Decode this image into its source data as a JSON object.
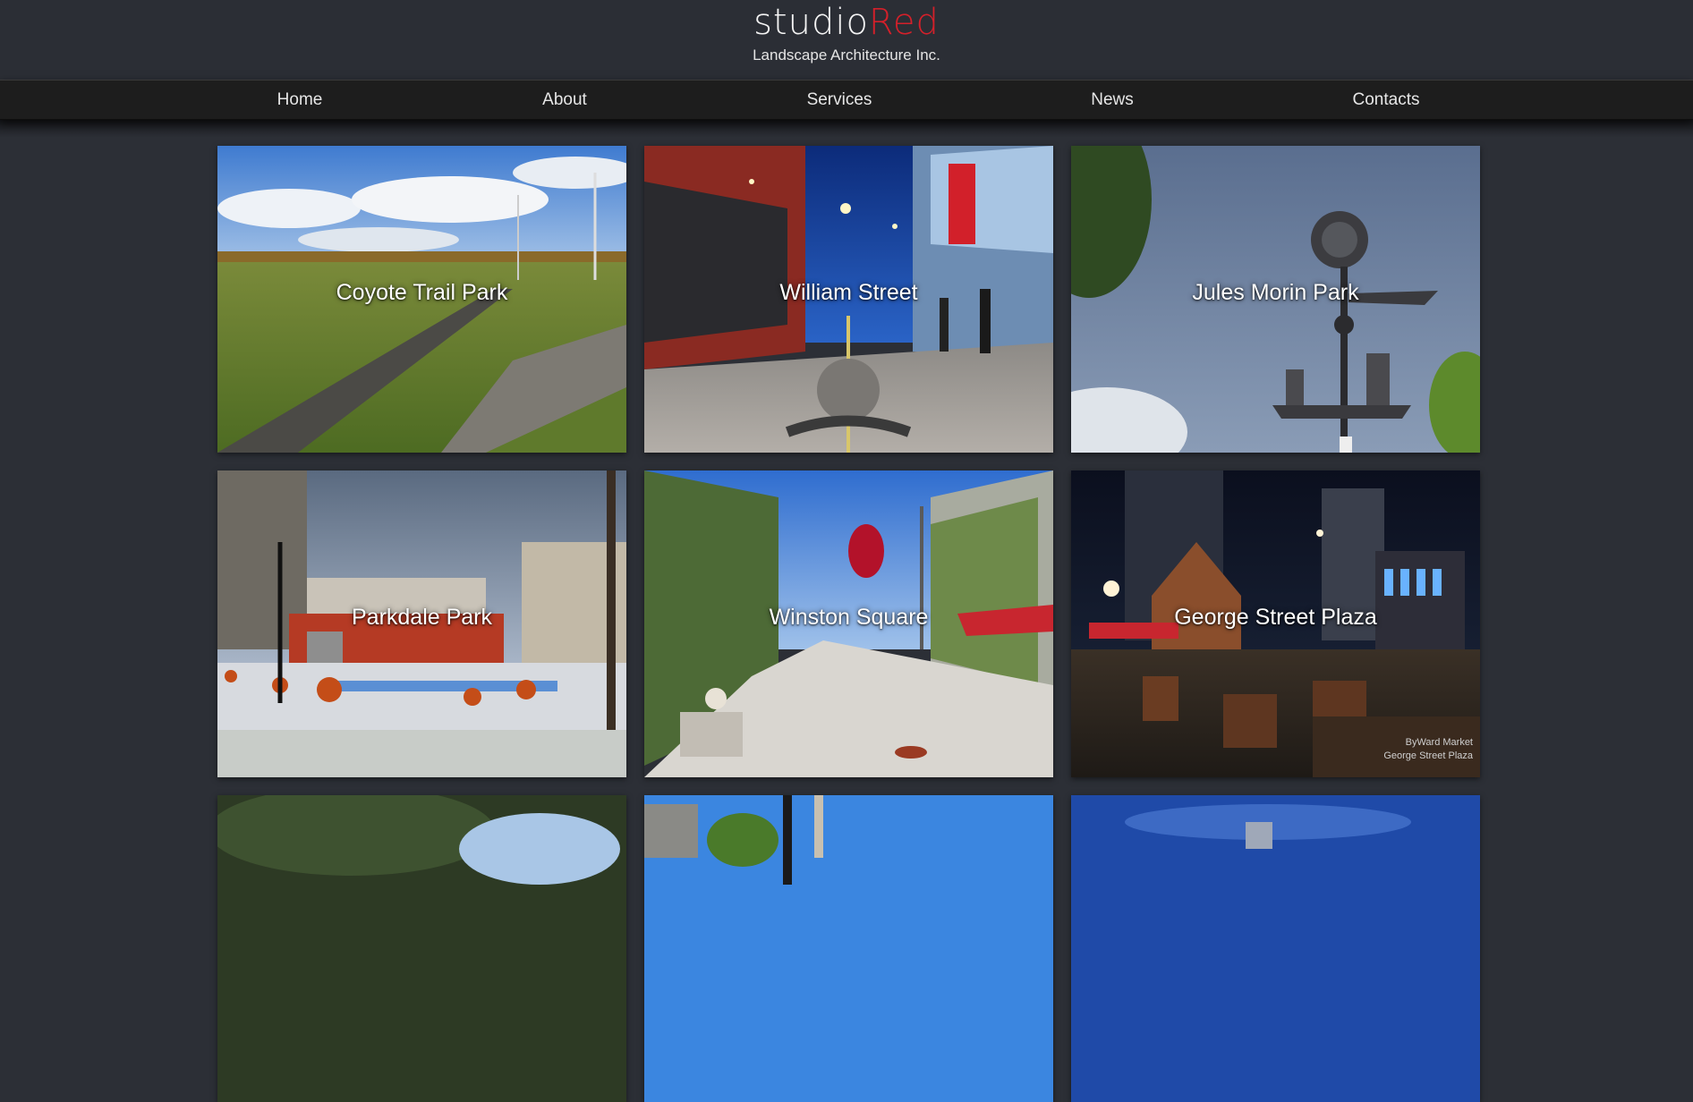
{
  "brand": {
    "logo_white": "studio",
    "logo_red": "Red",
    "tagline": "Landscape Architecture Inc."
  },
  "nav": {
    "items": [
      "Home",
      "About",
      "Services",
      "News",
      "Contacts"
    ]
  },
  "projects": [
    {
      "title": "Coyote Trail Park"
    },
    {
      "title": "William Street"
    },
    {
      "title": "Jules Morin Park"
    },
    {
      "title": "Parkdale Park"
    },
    {
      "title": "Winston Square"
    },
    {
      "title": "George Street Plaza",
      "watermark_line1": "ByWard Market",
      "watermark_line2": "George Street Plaza"
    }
  ],
  "colors": {
    "background": "#2c2f36",
    "nav_background": "#1d1d1d",
    "brand_red": "#d4202a"
  }
}
